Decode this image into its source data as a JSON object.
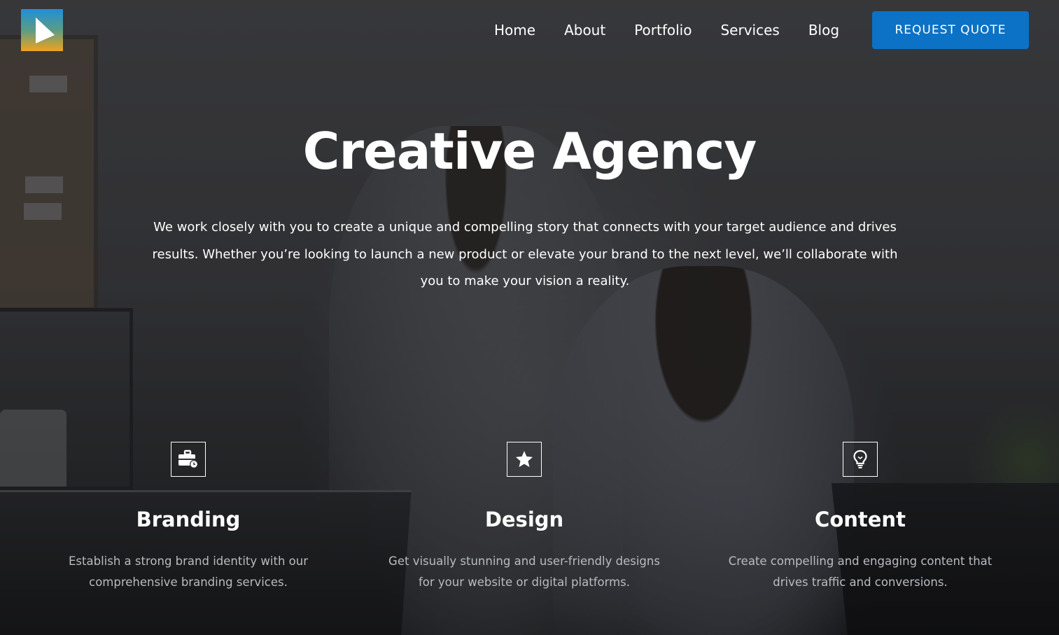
{
  "header": {
    "logo_icon": "paper-plane-arrow-icon",
    "nav": [
      {
        "label": "Home"
      },
      {
        "label": "About"
      },
      {
        "label": "Portfolio"
      },
      {
        "label": "Services"
      },
      {
        "label": "Blog"
      }
    ],
    "cta_label": "REQUEST QUOTE",
    "cta_color": "#0b72c6"
  },
  "hero": {
    "title": "Creative Agency",
    "description": "We work closely with you to create a unique and compelling story that connects with your target audience and drives results. Whether you’re looking to launch a new product or elevate your brand to the next level, we’ll collaborate with you to make your vision a reality."
  },
  "features": [
    {
      "icon": "briefcase-clock-icon",
      "title": "Branding",
      "text": "Establish a strong brand identity with our comprehensive branding services."
    },
    {
      "icon": "star-icon",
      "title": "Design",
      "text": "Get visually stunning and user-friendly designs for your website or digital platforms."
    },
    {
      "icon": "lightbulb-icon",
      "title": "Content",
      "text": "Create compelling and engaging content that drives traffic and conversions."
    }
  ]
}
